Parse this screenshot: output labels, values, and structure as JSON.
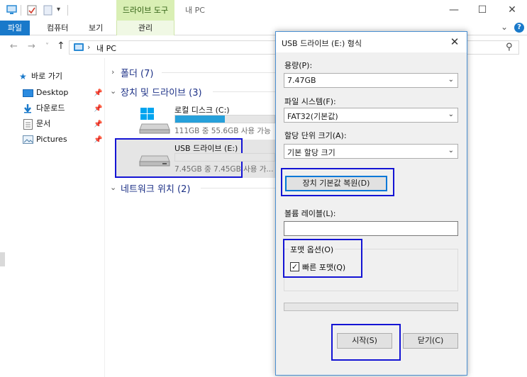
{
  "window": {
    "title": "내 PC",
    "contextual_tab_top": "드라이브 도구",
    "controls": {
      "minimize": "—",
      "maximize": "☐",
      "close": "✕"
    }
  },
  "ribbon": {
    "tabs": [
      "파일",
      "컴퓨터",
      "보기"
    ],
    "contextual_tab": "관리",
    "expand": "⌄",
    "help": "?"
  },
  "address": {
    "back": "←",
    "forward": "→",
    "recent": "˅",
    "up": "↑",
    "separator": "›",
    "path": "내 PC",
    "search_icon": "⚲"
  },
  "navpane": {
    "quick_access": "바로 가기",
    "items": [
      {
        "label": "Desktop",
        "pin": "📌"
      },
      {
        "label": "다운로드",
        "pin": "📌"
      },
      {
        "label": "문서",
        "pin": "📌"
      },
      {
        "label": "Pictures",
        "pin": "📌"
      }
    ]
  },
  "content": {
    "groups": [
      {
        "title": "폴더 (7)",
        "chevron": "›"
      },
      {
        "title": "장치 및 드라이브 (3)",
        "chevron": "⌄"
      },
      {
        "title": "네트워크 위치 (2)",
        "chevron": "⌄"
      }
    ],
    "drives": [
      {
        "name": "로컬 디스크 (C:)",
        "info": "111GB 중 55.6GB 사용 가능",
        "used_fraction": 0.5
      },
      {
        "name": "USB 드라이브 (E:)",
        "info": "7.45GB 중 7.45GB 사용 가...",
        "used_fraction": 0.0
      }
    ]
  },
  "dialog": {
    "title": "USB 드라이브 (E:) 형식",
    "close": "✕",
    "capacity_label": "용량(P):",
    "capacity_value": "7.47GB",
    "filesystem_label": "파일 시스템(F):",
    "filesystem_value": "FAT32(기본값)",
    "alloc_label": "할당 단위 크기(A):",
    "alloc_value": "기본 할당 크기",
    "restore_button": "장치 기본값 복원(D)",
    "volume_label": "볼륨 레이블(L):",
    "volume_value": "",
    "format_options_label": "포맷 옵션(O)",
    "quick_format_label": "빠른 포맷(Q)",
    "quick_format_checked": true,
    "start_button": "시작(S)",
    "close_button": "닫기(C)",
    "dropdown_arrow": "⌄",
    "check_mark": "✓"
  },
  "colors": {
    "accent": "#1979ca",
    "highlight": "#1414d4",
    "usage_bar": "#26a0da",
    "selection": "#cce8ff"
  }
}
